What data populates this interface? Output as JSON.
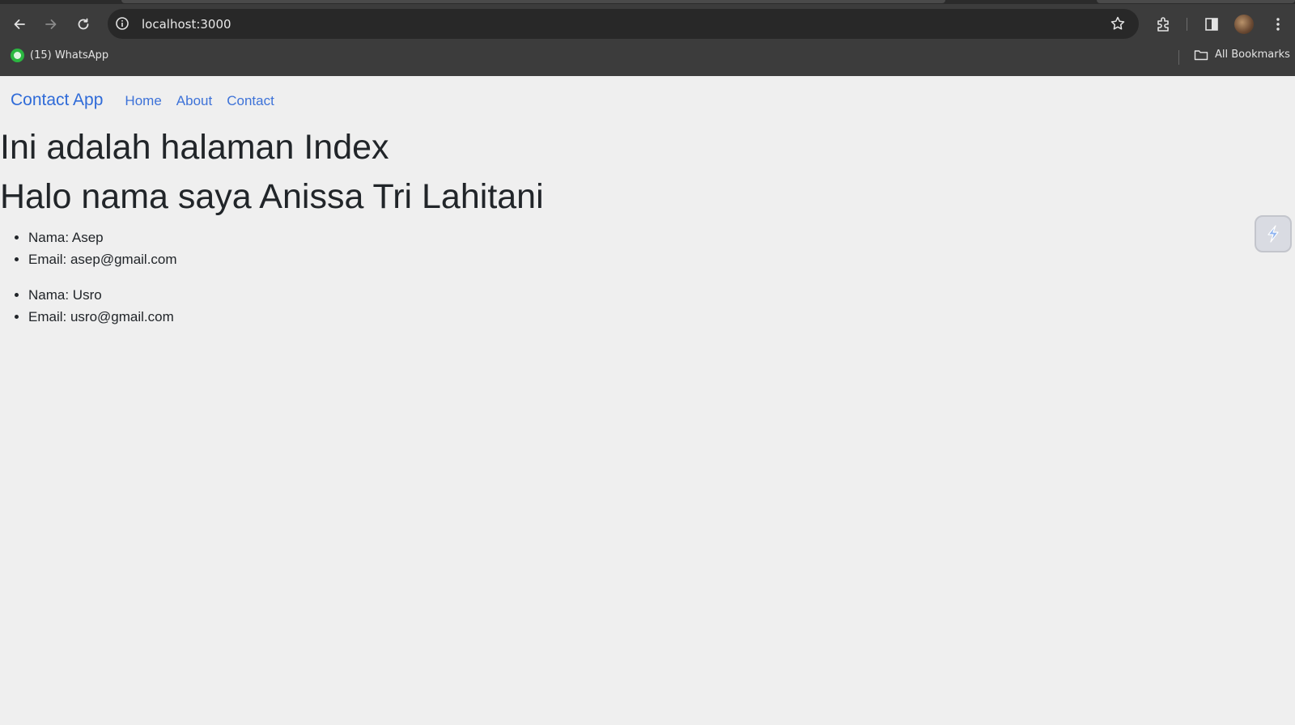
{
  "browser": {
    "url": "localhost:3000",
    "bookmarks": [
      {
        "label": "(15) WhatsApp",
        "icon": "whatsapp-icon"
      }
    ],
    "all_bookmarks_label": "All Bookmarks"
  },
  "navbar": {
    "brand": "Contact App",
    "links": [
      "Home",
      "About",
      "Contact"
    ],
    "link_color": "#3d72d8"
  },
  "main": {
    "heading_index": "Ini adalah halaman Index",
    "heading_greeting": "Halo nama saya Anissa Tri Lahitani",
    "contacts": [
      {
        "name_line": "Nama: Asep",
        "email_line": "Email: asep@gmail.com"
      },
      {
        "name_line": "Nama: Usro",
        "email_line": "Email: usro@gmail.com"
      }
    ]
  },
  "colors": {
    "page_background": "#efefef",
    "browser_chrome": "#3c3c3c",
    "omnibox": "#282828"
  }
}
